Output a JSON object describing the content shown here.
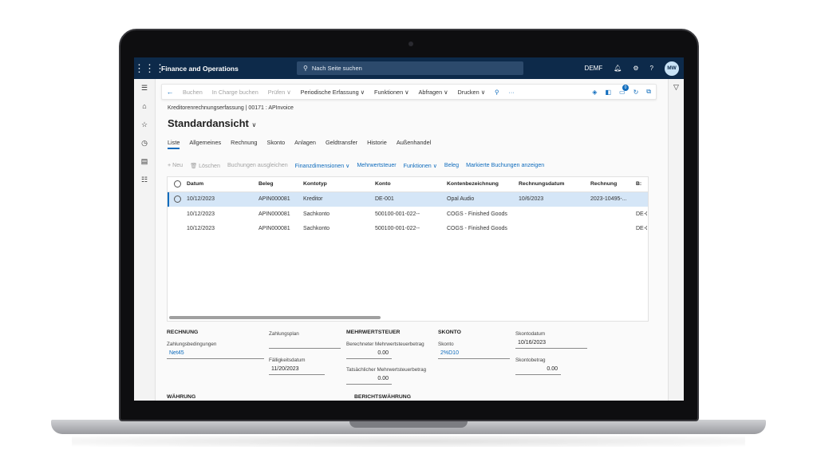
{
  "topbar": {
    "app_name": "Finance and Operations",
    "search_placeholder": "Nach Seite suchen",
    "company": "DEMF",
    "help": "?",
    "user_initials": "MW"
  },
  "action_pane": {
    "items": [
      {
        "label": "Buchen",
        "enabled": false
      },
      {
        "label": "In Charge buchen",
        "enabled": false
      },
      {
        "label": "Prüfen ∨",
        "enabled": false
      },
      {
        "label": "Periodische Erfassung ∨",
        "enabled": true
      },
      {
        "label": "Funktionen ∨",
        "enabled": true
      },
      {
        "label": "Abfragen ∨",
        "enabled": true
      },
      {
        "label": "Drucken ∨",
        "enabled": true
      }
    ],
    "more": "···",
    "notification_count": "0"
  },
  "breadcrumb": "Kreditorenrechnungserfassung   |   00171 : APInvoice",
  "view_title": "Standardansicht",
  "tabs": [
    "Liste",
    "Allgemeines",
    "Rechnung",
    "Skonto",
    "Anlagen",
    "Geldtransfer",
    "Historie",
    "Außenhandel"
  ],
  "grid_toolbar": [
    {
      "label": "+ Neu",
      "enabled": false
    },
    {
      "label": "🗑 Löschen",
      "enabled": false
    },
    {
      "label": "Buchungen ausgleichen",
      "enabled": false
    },
    {
      "label": "Finanzdimensionen ∨",
      "enabled": true
    },
    {
      "label": "Mehrwertsteuer",
      "enabled": true
    },
    {
      "label": "Funktionen ∨",
      "enabled": true
    },
    {
      "label": "Beleg",
      "enabled": true
    },
    {
      "label": "Markierte Buchungen anzeigen",
      "enabled": true
    }
  ],
  "grid": {
    "columns": [
      "Datum",
      "Beleg",
      "Kontotyp",
      "Konto",
      "Kontenbezeichnung",
      "Rechnungsdatum",
      "Rechnung",
      "B:"
    ],
    "rows": [
      [
        "10/12/2023",
        "APIN000081",
        "Kreditor",
        "DE-001",
        "Opal Audio",
        "10/6/2023",
        "2023-10495-...",
        ""
      ],
      [
        "10/12/2023",
        "APIN000081",
        "Sachkonto",
        "500100-001-022--",
        "COGS - Finished Goods",
        "",
        "",
        "DE-C"
      ],
      [
        "10/12/2023",
        "APIN000081",
        "Sachkonto",
        "500100-001-022--",
        "COGS - Finished Goods",
        "",
        "",
        "DE-C"
      ]
    ]
  },
  "details": {
    "rechnung": {
      "header": "RECHNUNG",
      "zahlungsbedingungen_label": "Zahlungsbedingungen",
      "zahlungsbedingungen_value": "Net45",
      "zahlungsplan_label": "Zahlungsplan",
      "zahlungsplan_value": "",
      "faelligkeitsdatum_label": "Fälligkeitsdatum",
      "faelligkeitsdatum_value": "11/20/2023"
    },
    "mwst": {
      "header": "MEHRWERTSTEUER",
      "berechnet_label": "Berechneter Mehrwertsteuerbetrag",
      "berechnet_value": "0.00",
      "tatsaechlich_label": "Tatsächlicher Mehrwertsteuerbetrag",
      "tatsaechlich_value": "0.00"
    },
    "skonto": {
      "header": "SKONTO",
      "skonto_label": "Skonto",
      "skonto_value": "2%D10",
      "skontodatum_label": "Skontodatum",
      "skontodatum_value": "10/16/2023",
      "skontobetrag_label": "Skontobetrag",
      "skontobetrag_value": "0.00"
    },
    "waehrung_header": "WÄHRUNG",
    "berichtswaehrung_header": "BERICHTSWÄHRUNG"
  }
}
